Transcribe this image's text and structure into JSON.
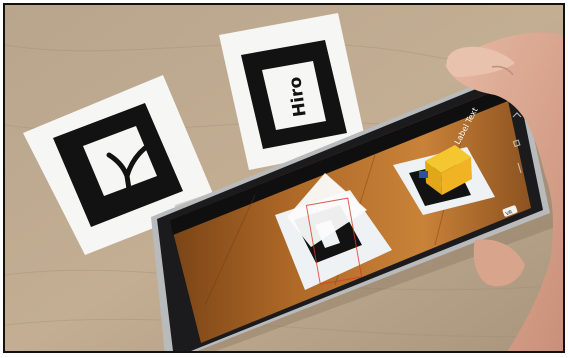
{
  "photo": {
    "marker_left_symbol": "Y",
    "marker_hiro_text": "Hiro",
    "phone_label_text": "Label Text",
    "phone_badge": "VR"
  }
}
